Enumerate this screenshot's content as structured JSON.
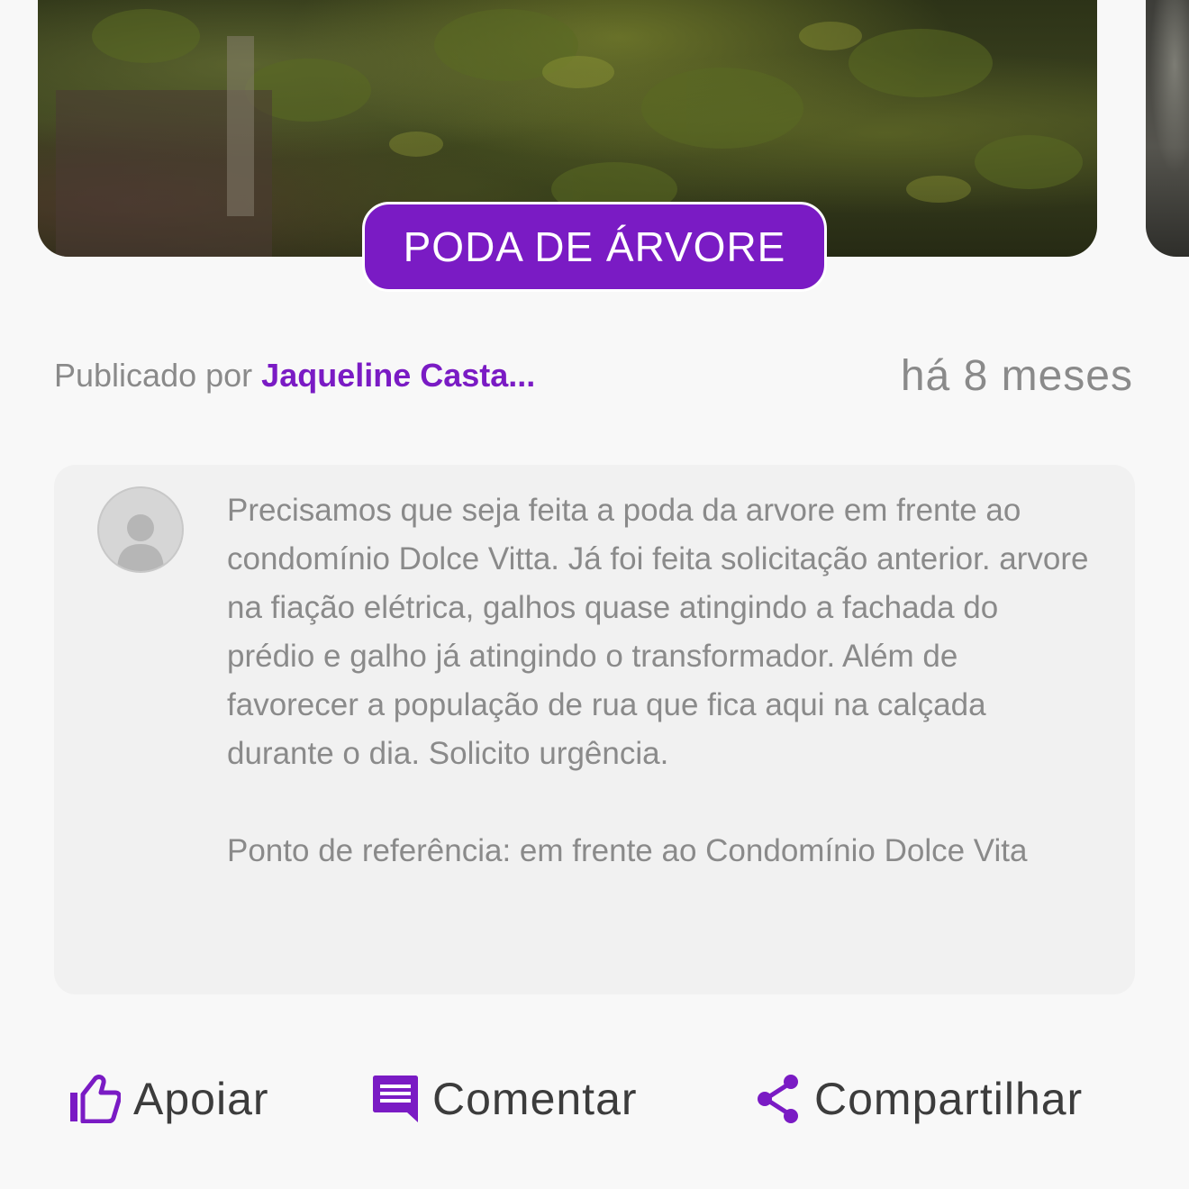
{
  "post": {
    "category": "PODA DE ÁRVORE",
    "published_by_label": "Publicado por",
    "author": "Jaqueline Casta...",
    "time_ago": "há 8 meses",
    "description": "Precisamos que seja feita a poda da arvore em frente ao condomínio Dolce Vitta. Já foi feita solicitação anterior. arvore na fiação elétrica, galhos quase atingindo a fachada do prédio e galho já atingindo o transformador. Além de favorecer a população de rua que fica aqui na calçada durante o dia. Solicito urgência.\n\nPonto de referência: em frente ao Condomínio Dolce Vita"
  },
  "actions": {
    "support_label": "Apoiar",
    "comment_label": "Comentar",
    "share_label": "Compartilhar"
  },
  "icons": {
    "support": "thumbs-up-icon",
    "comment": "comment-icon",
    "share": "share-icon",
    "avatar": "user-placeholder-icon"
  },
  "colors": {
    "accent": "#7a1bc4",
    "text_muted": "#8a8a8a",
    "text_dark": "#3c3c3c",
    "card_bg": "#f1f1f1",
    "page_bg": "#f8f8f8"
  }
}
